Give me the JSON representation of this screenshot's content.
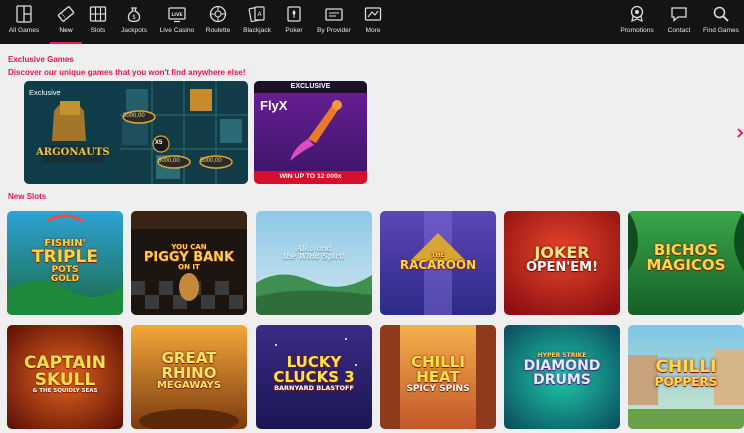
{
  "nav": {
    "left": [
      {
        "label": "All Games",
        "icon": "grid-icon"
      },
      {
        "label": "New",
        "icon": "ticket-icon",
        "active": true
      },
      {
        "label": "Slots",
        "icon": "slots-icon"
      },
      {
        "label": "Jackpots",
        "icon": "money-bag-icon"
      },
      {
        "label": "Live Casino",
        "icon": "live-icon"
      },
      {
        "label": "Roulette",
        "icon": "roulette-icon"
      },
      {
        "label": "Blackjack",
        "icon": "cards-icon"
      },
      {
        "label": "Poker",
        "icon": "poker-icon"
      },
      {
        "label": "By Provider",
        "icon": "provider-icon"
      },
      {
        "label": "More",
        "icon": "more-icon"
      }
    ],
    "right": [
      {
        "label": "Promotions",
        "icon": "gift-icon"
      },
      {
        "label": "Contact",
        "icon": "chat-icon"
      },
      {
        "label": "Find Games",
        "icon": "search-icon"
      }
    ],
    "accent": "#e91e4e"
  },
  "exclusive": {
    "title": "Exclusive Games",
    "subtitle": "Discover our unique games that you won't find anywhere else!",
    "tiles": [
      {
        "tag": "Exclusive",
        "name": "ARGONAUTS",
        "values": [
          "3000,00",
          "5000,00",
          "5000,00"
        ],
        "multiplier": "X5"
      },
      {
        "banner": "EXCLUSIVE",
        "name": "FlyX",
        "win": "WIN UP TO 12 000x"
      }
    ]
  },
  "new_slots": {
    "title": "New Slots",
    "row1": [
      {
        "name_lines": [
          "FISHIN'",
          "TRIPLE",
          "POTS",
          "GOLD"
        ]
      },
      {
        "name_lines": [
          "YOU CAN",
          "PIGGY BANK",
          "ON IT"
        ]
      },
      {
        "name_lines": [
          "Aiko and",
          "the Wind Spirit"
        ]
      },
      {
        "name_lines": [
          "THE",
          "RACAROON"
        ]
      },
      {
        "name_lines": [
          "JOKER",
          "OPEN'EM!"
        ]
      },
      {
        "name_lines": [
          "BICHOS",
          "MÁGICOS"
        ]
      }
    ],
    "row2": [
      {
        "name_lines": [
          "CAPTAIN",
          "SKULL",
          "& THE SQUIDLY SEAS"
        ]
      },
      {
        "name_lines": [
          "GREAT",
          "RHINO",
          "MEGAWAYS"
        ]
      },
      {
        "name_lines": [
          "LUCKY",
          "CLUCKS 3",
          "BARNYARD BLASTOFF"
        ]
      },
      {
        "name_lines": [
          "CHILLI",
          "HEAT",
          "SPICY SPINS"
        ]
      },
      {
        "name_lines": [
          "HYPER STRIKE",
          "DIAMOND",
          "DRUMS"
        ]
      },
      {
        "name_lines": [
          "CHILLI",
          "POPPERS"
        ]
      }
    ]
  }
}
